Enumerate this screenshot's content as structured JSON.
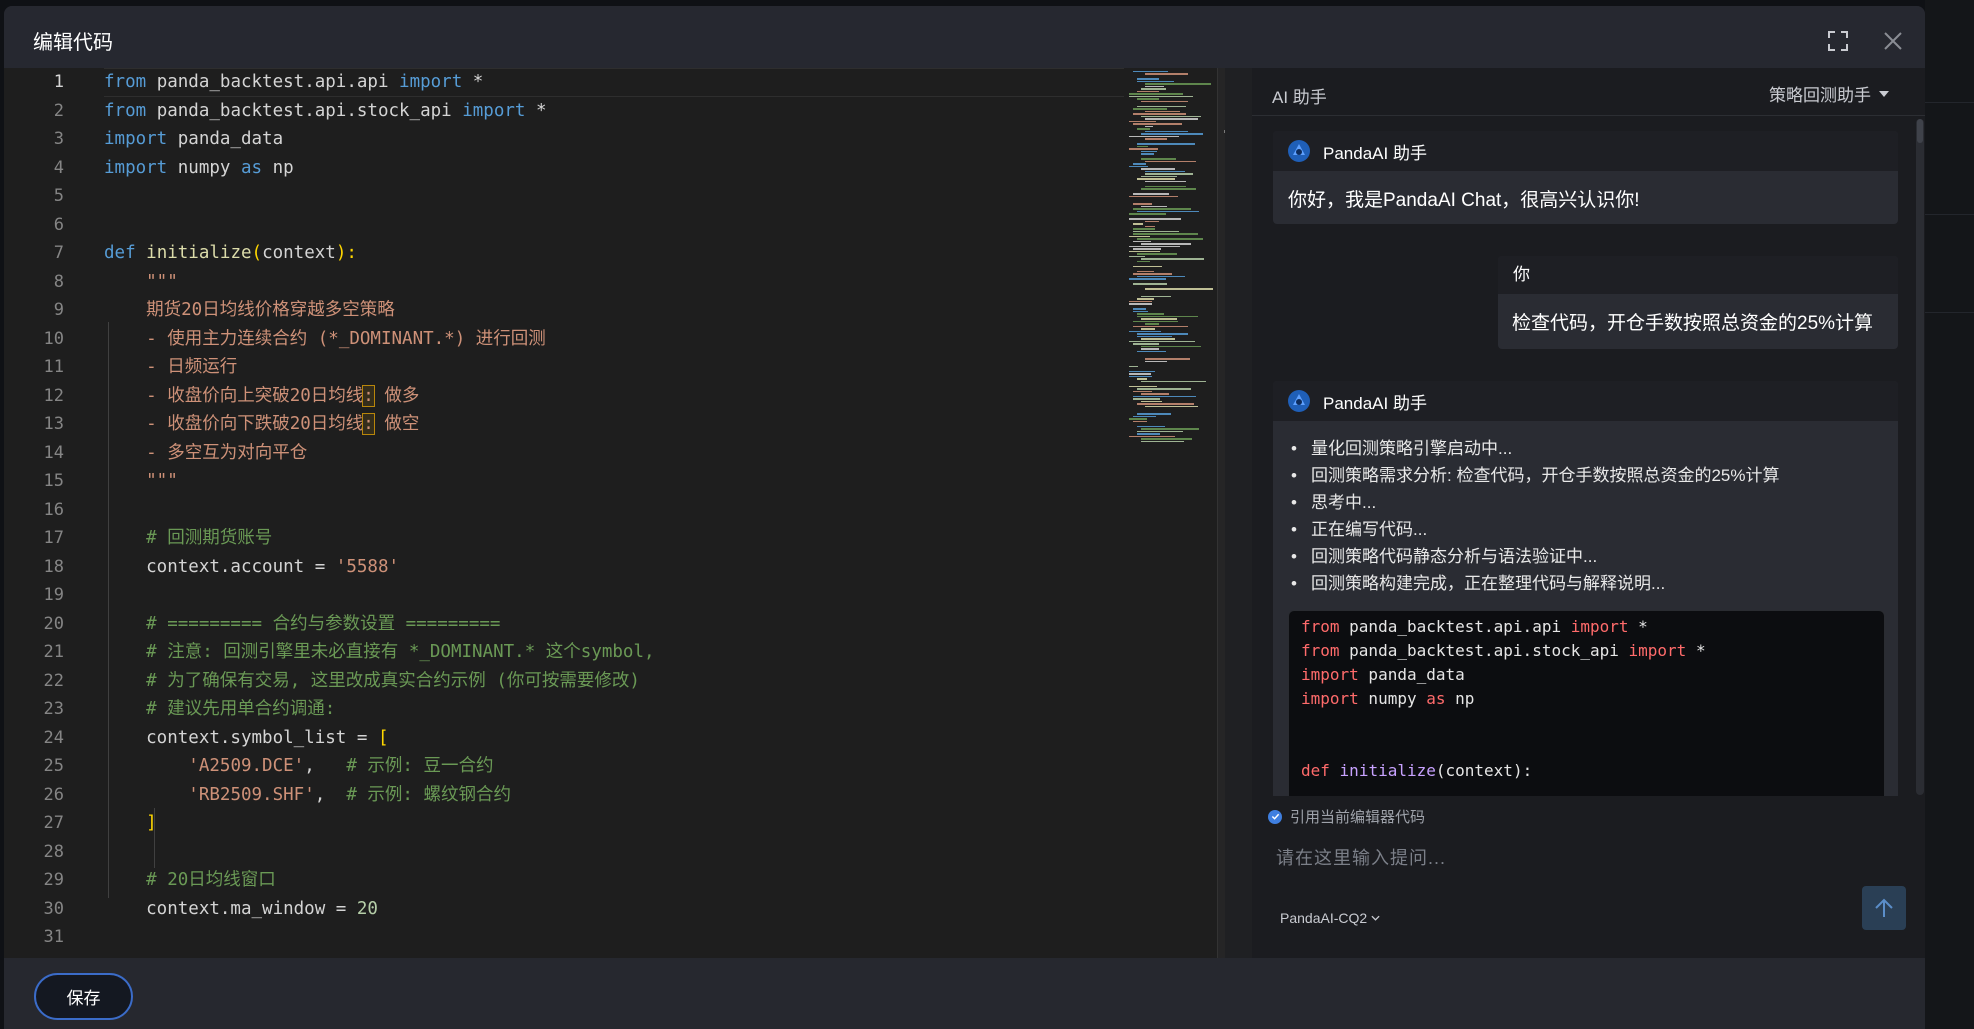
{
  "dialog": {
    "title": "编辑代码"
  },
  "editor": {
    "line_numbers": [
      "1",
      "2",
      "3",
      "4",
      "5",
      "6",
      "7",
      "8",
      "9",
      "10",
      "11",
      "12",
      "13",
      "14",
      "15",
      "16",
      "17",
      "18",
      "19",
      "20",
      "21",
      "22",
      "23",
      "24",
      "25",
      "26",
      "27",
      "28",
      "29",
      "30",
      "31"
    ],
    "lines": {
      "l1": {
        "a": "from",
        "b": " panda_backtest.api.api ",
        "c": "import",
        "d": " *"
      },
      "l2": {
        "a": "from",
        "b": " panda_backtest.api.stock_api ",
        "c": "import",
        "d": " *"
      },
      "l3": {
        "a": "import",
        "b": " panda_data"
      },
      "l4": {
        "a": "import",
        "b": " numpy ",
        "c": "as",
        "d": " np"
      },
      "l7": {
        "a": "def",
        "b": "initialize",
        "c": "(",
        "d": "context",
        "e": "):"
      },
      "l8": "    \"\"\"",
      "l9": "    期货20日均线价格穿越多空策略",
      "l10": "    - 使用主力连续合约 (*_DOMINANT.*) 进行回测",
      "l11": "    - 日频运行",
      "l12": {
        "a": "    - 收盘价向上突破20日均线",
        "b": ":",
        "c": " 做多"
      },
      "l13": {
        "a": "    - 收盘价向下跌破20日均线",
        "b": ":",
        "c": " 做空"
      },
      "l14": "    - 多空互为对向平仓",
      "l15": "    \"\"\"",
      "l17": "    # 回测期货账号",
      "l18": {
        "a": "    context.account = ",
        "b": "'5588'"
      },
      "l20": "    # ========= 合约与参数设置 =========",
      "l21": "    # 注意: 回测引擎里未必直接有 *_DOMINANT.* 这个symbol,",
      "l22": "    # 为了确保有交易, 这里改成真实合约示例 (你可按需要修改)",
      "l23": "    # 建议先用单合约调通:",
      "l24": {
        "a": "    context.symbol_list = ",
        "b": "["
      },
      "l25": {
        "a": "        ",
        "b": "'A2509.DCE'",
        "c": ",   ",
        "d": "# 示例: 豆一合约"
      },
      "l26": {
        "a": "        ",
        "b": "'RB2509.SHF'",
        "c": ",  ",
        "d": "# 示例: 螺纹钢合约"
      },
      "l27": {
        "a": "    ",
        "b": "]"
      },
      "l29": "    # 20日均线窗口",
      "l30": {
        "a": "    context.ma_window = ",
        "b": "20"
      }
    }
  },
  "ai": {
    "panel_title": "AI 助手",
    "mode": "策略回测助手",
    "assistant_name": "PandaAI 助手",
    "greeting": "你好，我是PandaAI Chat，很高兴认识你!",
    "user_name": "你",
    "user_message": "检查代码，开仓手数按照总资金的25%计算",
    "steps": [
      "量化回测策略引擎启动中...",
      "回测策略需求分析:  检查代码，开仓手数按照总资金的25%计算",
      "思考中...",
      "正在编写代码...",
      "回测策略代码静态分析与语法验证中...",
      "回测策略构建完成，正在整理代码与解释说明..."
    ],
    "code_preview": {
      "c1": {
        "a": "from",
        "b": " panda_backtest.api.api ",
        "c": "import",
        "d": " *"
      },
      "c2": {
        "a": "from",
        "b": " panda_backtest.api.stock_api ",
        "c": "import",
        "d": " *"
      },
      "c3": {
        "a": "import",
        "b": " panda_data"
      },
      "c4": {
        "a": "import",
        "b": " numpy ",
        "c": "as",
        "d": " np"
      },
      "c7": {
        "a": "def",
        "b": " ",
        "c": "initialize",
        "d": "(context):"
      }
    },
    "reference_label": "引用当前编辑器代码",
    "input_placeholder": "请在这里输入提问...",
    "model": "PandaAI-CQ2"
  },
  "footer": {
    "save_label": "保存"
  },
  "colors": {
    "accent": "#3b6cc9",
    "keyword": "#569cd6",
    "string": "#ce9178",
    "comment": "#6a9955"
  },
  "icons": [
    "fullscreen-icon",
    "close-icon",
    "panda-logo-icon",
    "chevron-down-icon",
    "check-icon",
    "arrow-up-icon"
  ]
}
